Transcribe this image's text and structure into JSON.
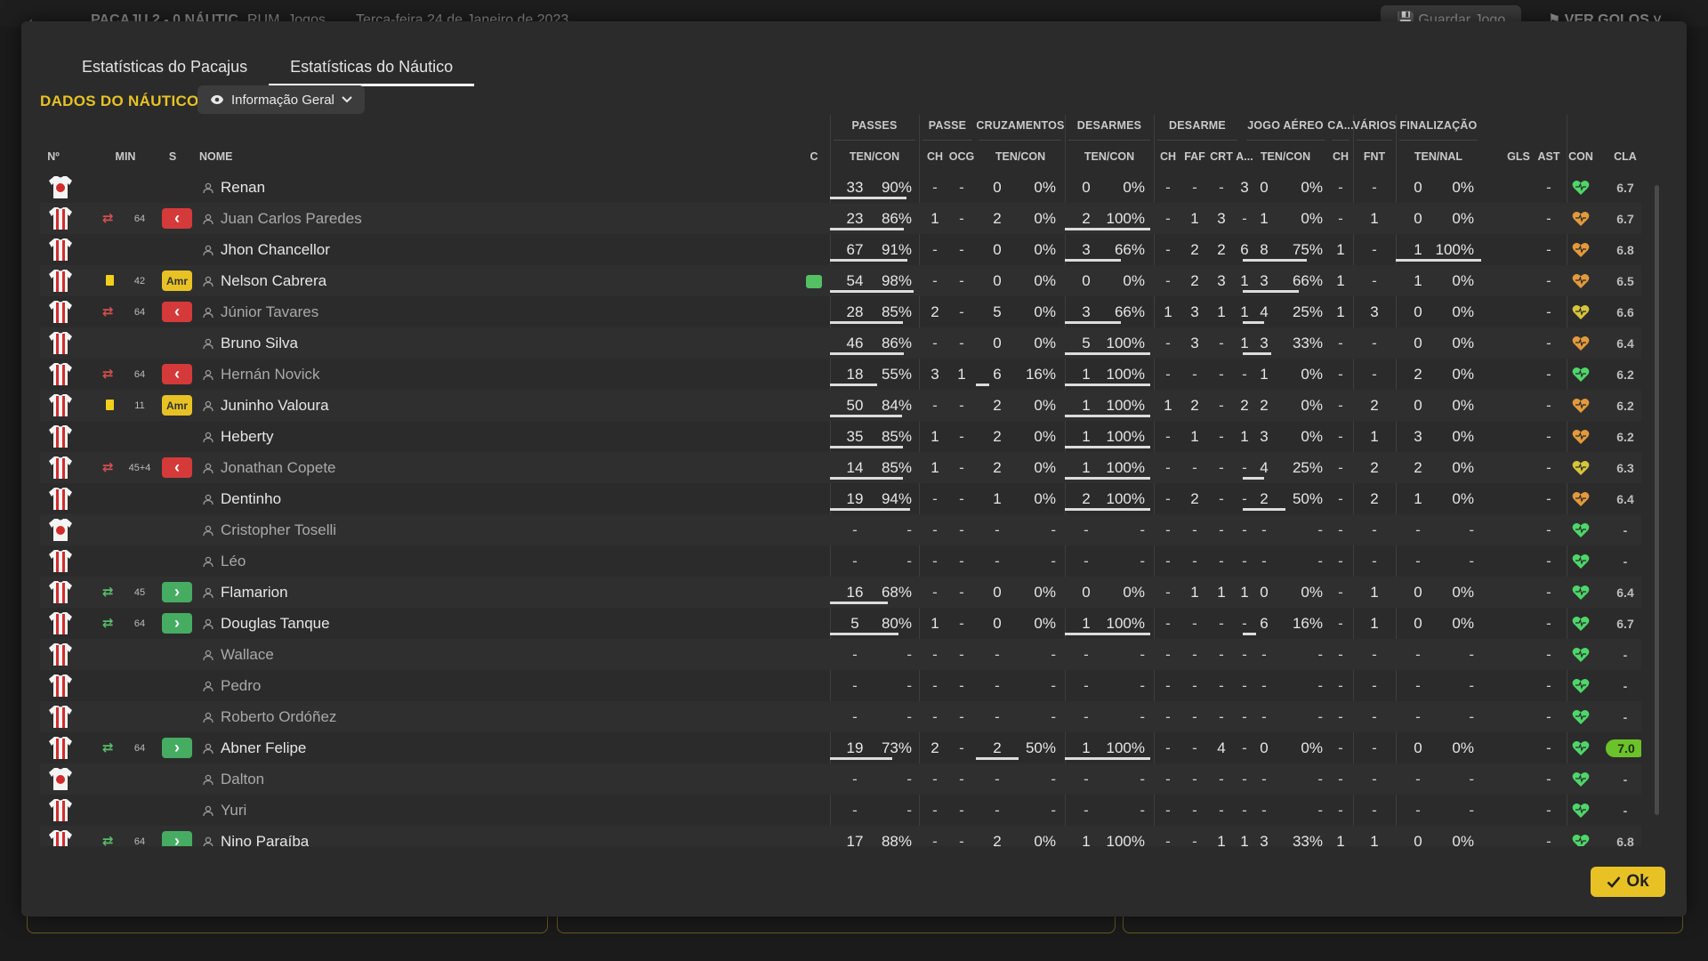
{
  "header": {
    "back_icon": "arrow-left-icon",
    "match": "PACAJU 2 - 0 NÁUTIC",
    "subtitle": "RUM, Jogos",
    "date": "Terça-feira 24 de Janeiro de 2023",
    "save_label": "Guardar Jogo",
    "goals_label": "VER GOLOS"
  },
  "tabs": [
    {
      "label": "Estatísticas do Pacajus",
      "active": false
    },
    {
      "label": "Estatísticas do Náutico",
      "active": true
    }
  ],
  "section_title": "DADOS DO NÁUTICO",
  "view_dropdown": {
    "label": "Informação Geral",
    "icon": "eye-icon"
  },
  "ok_label": "Ok",
  "group_headers": {
    "passes": "PASSES",
    "passe": "PASSE",
    "cruz": "CRUZAMENTOS",
    "desarmes": "DESARMES",
    "desarme": "DESARME",
    "jogo_aereo": "JOGO AÉREO",
    "ca": "CA...",
    "varios": "VÁRIOS",
    "finalizacao": "FINALIZAÇÃO"
  },
  "columns": {
    "num": "Nº",
    "min": "MIN",
    "s": "S",
    "nome": "NOME",
    "c": "C",
    "passes": "TEN/CON",
    "passe_ch": "CH",
    "passe_ocg": "OCG",
    "cruz": "TEN/CON",
    "desarmes": "TEN/CON",
    "desarme_ch": "CH",
    "desarme_faf": "FAF",
    "desarme_crt": "CRT",
    "desarme_a": "A...",
    "aereo": "TEN/CON",
    "ca_ch": "CH",
    "varios_fnt": "FNT",
    "final": "TEN/NAL",
    "gls": "GLS",
    "ast": "AST",
    "con": "CON",
    "cla": "CLA"
  },
  "colors": {
    "accent": "#e8c224",
    "sub_out": "#d53a3a",
    "sub_in": "#46ac62",
    "heart_green": "#4ed66a",
    "heart_orange": "#e39a3c",
    "heart_yellow": "#d6c53a"
  },
  "players": [
    {
      "kit": "white",
      "name": "Renan",
      "active": true,
      "min": "",
      "sub": "",
      "card": "",
      "pt": "33",
      "pc": "90%",
      "pp": 0.9,
      "pch": "-",
      "ocg": "-",
      "ct": "0",
      "cc": "0%",
      "cp": 0,
      "dt": "0",
      "dc": "0%",
      "dp": 0,
      "d_ch": "-",
      "faf": "-",
      "crt": "-",
      "da": "3",
      "at": "0",
      "ac": "0%",
      "ap": 0,
      "ca": "-",
      "fnt": "-",
      "ft": "0",
      "fc": "0%",
      "fp": 0,
      "gls": "",
      "ast": "-",
      "con": "green",
      "cla": "6.7",
      "best": false,
      "kitmark": false
    },
    {
      "kit": "striped",
      "name": "Juan Carlos Paredes",
      "active": false,
      "min": "64",
      "sub": "out",
      "card": "",
      "pt": "23",
      "pc": "86%",
      "pp": 0.86,
      "pch": "1",
      "ocg": "-",
      "ct": "2",
      "cc": "0%",
      "cp": 0,
      "dt": "2",
      "dc": "100%",
      "dp": 1,
      "d_ch": "-",
      "faf": "1",
      "crt": "3",
      "da": "-",
      "at": "1",
      "ac": "0%",
      "ap": 0,
      "ca": "-",
      "fnt": "1",
      "ft": "0",
      "fc": "0%",
      "fp": 0,
      "gls": "",
      "ast": "-",
      "con": "orange",
      "cla": "6.7",
      "best": false,
      "kitmark": false
    },
    {
      "kit": "striped",
      "name": "Jhon Chancellor",
      "active": true,
      "min": "",
      "sub": "",
      "card": "",
      "pt": "67",
      "pc": "91%",
      "pp": 0.91,
      "pch": "-",
      "ocg": "-",
      "ct": "0",
      "cc": "0%",
      "cp": 0,
      "dt": "3",
      "dc": "66%",
      "dp": 0.66,
      "d_ch": "-",
      "faf": "2",
      "crt": "2",
      "da": "6",
      "at": "8",
      "ac": "75%",
      "ap": 0.75,
      "ca": "1",
      "fnt": "-",
      "ft": "1",
      "fc": "100%",
      "fp": 1,
      "gls": "",
      "ast": "-",
      "con": "orange",
      "cla": "6.8",
      "best": false,
      "kitmark": false
    },
    {
      "kit": "striped",
      "name": "Nelson Cabrera",
      "active": true,
      "min": "42",
      "sub": "",
      "card": "yellow",
      "pt": "54",
      "pc": "98%",
      "pp": 0.98,
      "pch": "-",
      "ocg": "-",
      "ct": "0",
      "cc": "0%",
      "cp": 0,
      "dt": "0",
      "dc": "0%",
      "dp": 0,
      "d_ch": "-",
      "faf": "2",
      "crt": "3",
      "da": "1",
      "at": "3",
      "ac": "66%",
      "ap": 0.66,
      "ca": "1",
      "fnt": "-",
      "ft": "1",
      "fc": "0%",
      "fp": 0,
      "gls": "",
      "ast": "-",
      "con": "orange",
      "cla": "6.5",
      "best": false,
      "kitmark": true
    },
    {
      "kit": "striped",
      "name": "Júnior Tavares",
      "active": false,
      "min": "64",
      "sub": "out",
      "card": "",
      "pt": "28",
      "pc": "85%",
      "pp": 0.85,
      "pch": "2",
      "ocg": "-",
      "ct": "5",
      "cc": "0%",
      "cp": 0,
      "dt": "3",
      "dc": "66%",
      "dp": 0.66,
      "d_ch": "1",
      "faf": "3",
      "crt": "1",
      "da": "1",
      "at": "4",
      "ac": "25%",
      "ap": 0.25,
      "ca": "1",
      "fnt": "3",
      "ft": "0",
      "fc": "0%",
      "fp": 0,
      "gls": "",
      "ast": "-",
      "con": "yellow",
      "cla": "6.6",
      "best": false,
      "kitmark": false
    },
    {
      "kit": "striped",
      "name": "Bruno Silva",
      "active": true,
      "min": "",
      "sub": "",
      "card": "",
      "pt": "46",
      "pc": "86%",
      "pp": 0.86,
      "pch": "-",
      "ocg": "-",
      "ct": "0",
      "cc": "0%",
      "cp": 0,
      "dt": "5",
      "dc": "100%",
      "dp": 1,
      "d_ch": "-",
      "faf": "3",
      "crt": "-",
      "da": "1",
      "at": "3",
      "ac": "33%",
      "ap": 0.33,
      "ca": "-",
      "fnt": "-",
      "ft": "0",
      "fc": "0%",
      "fp": 0,
      "gls": "",
      "ast": "-",
      "con": "orange",
      "cla": "6.4",
      "best": false,
      "kitmark": false
    },
    {
      "kit": "striped",
      "name": "Hernán Novick",
      "active": false,
      "min": "64",
      "sub": "out",
      "card": "",
      "pt": "18",
      "pc": "55%",
      "pp": 0.55,
      "pch": "3",
      "ocg": "1",
      "ct": "6",
      "cc": "16%",
      "cp": 0.16,
      "dt": "1",
      "dc": "100%",
      "dp": 1,
      "d_ch": "-",
      "faf": "-",
      "crt": "-",
      "da": "-",
      "at": "1",
      "ac": "0%",
      "ap": 0,
      "ca": "-",
      "fnt": "-",
      "ft": "2",
      "fc": "0%",
      "fp": 0,
      "gls": "",
      "ast": "-",
      "con": "green",
      "cla": "6.2",
      "best": false,
      "kitmark": false
    },
    {
      "kit": "striped",
      "name": "Juninho Valoura",
      "active": true,
      "min": "11",
      "sub": "",
      "card": "yellow",
      "pt": "50",
      "pc": "84%",
      "pp": 0.84,
      "pch": "-",
      "ocg": "-",
      "ct": "2",
      "cc": "0%",
      "cp": 0,
      "dt": "1",
      "dc": "100%",
      "dp": 1,
      "d_ch": "1",
      "faf": "2",
      "crt": "-",
      "da": "2",
      "at": "2",
      "ac": "0%",
      "ap": 0,
      "ca": "-",
      "fnt": "2",
      "ft": "0",
      "fc": "0%",
      "fp": 0,
      "gls": "",
      "ast": "-",
      "con": "orange",
      "cla": "6.2",
      "best": false,
      "kitmark": false
    },
    {
      "kit": "striped",
      "name": "Heberty",
      "active": true,
      "min": "",
      "sub": "",
      "card": "",
      "pt": "35",
      "pc": "85%",
      "pp": 0.85,
      "pch": "1",
      "ocg": "-",
      "ct": "2",
      "cc": "0%",
      "cp": 0,
      "dt": "1",
      "dc": "100%",
      "dp": 1,
      "d_ch": "-",
      "faf": "1",
      "crt": "-",
      "da": "1",
      "at": "3",
      "ac": "0%",
      "ap": 0,
      "ca": "-",
      "fnt": "1",
      "ft": "3",
      "fc": "0%",
      "fp": 0,
      "gls": "",
      "ast": "-",
      "con": "orange",
      "cla": "6.2",
      "best": false,
      "kitmark": false
    },
    {
      "kit": "striped",
      "name": "Jonathan Copete",
      "active": false,
      "min": "45+4",
      "sub": "out",
      "card": "",
      "pt": "14",
      "pc": "85%",
      "pp": 0.85,
      "pch": "1",
      "ocg": "-",
      "ct": "2",
      "cc": "0%",
      "cp": 0,
      "dt": "1",
      "dc": "100%",
      "dp": 1,
      "d_ch": "-",
      "faf": "-",
      "crt": "-",
      "da": "-",
      "at": "4",
      "ac": "25%",
      "ap": 0.25,
      "ca": "-",
      "fnt": "2",
      "ft": "2",
      "fc": "0%",
      "fp": 0,
      "gls": "",
      "ast": "-",
      "con": "yellow",
      "cla": "6.3",
      "best": false,
      "kitmark": false
    },
    {
      "kit": "striped",
      "name": "Dentinho",
      "active": true,
      "min": "",
      "sub": "",
      "card": "",
      "pt": "19",
      "pc": "94%",
      "pp": 0.94,
      "pch": "-",
      "ocg": "-",
      "ct": "1",
      "cc": "0%",
      "cp": 0,
      "dt": "2",
      "dc": "100%",
      "dp": 1,
      "d_ch": "-",
      "faf": "2",
      "crt": "-",
      "da": "-",
      "at": "2",
      "ac": "50%",
      "ap": 0.5,
      "ca": "-",
      "fnt": "2",
      "ft": "1",
      "fc": "0%",
      "fp": 0,
      "gls": "",
      "ast": "-",
      "con": "orange",
      "cla": "6.4",
      "best": false,
      "kitmark": false
    },
    {
      "kit": "white",
      "name": "Cristopher Toselli",
      "active": false,
      "min": "",
      "sub": "",
      "card": "",
      "pt": "-",
      "pc": "-",
      "pp": 0,
      "pch": "-",
      "ocg": "-",
      "ct": "-",
      "cc": "-",
      "cp": 0,
      "dt": "-",
      "dc": "-",
      "dp": 0,
      "d_ch": "-",
      "faf": "-",
      "crt": "-",
      "da": "-",
      "at": "-",
      "ac": "-",
      "ap": 0,
      "ca": "-",
      "fnt": "-",
      "ft": "-",
      "fc": "-",
      "fp": 0,
      "gls": "",
      "ast": "-",
      "con": "green",
      "cla": "-",
      "best": false,
      "kitmark": false
    },
    {
      "kit": "striped",
      "name": "Léo",
      "active": false,
      "min": "",
      "sub": "",
      "card": "",
      "pt": "-",
      "pc": "-",
      "pp": 0,
      "pch": "-",
      "ocg": "-",
      "ct": "-",
      "cc": "-",
      "cp": 0,
      "dt": "-",
      "dc": "-",
      "dp": 0,
      "d_ch": "-",
      "faf": "-",
      "crt": "-",
      "da": "-",
      "at": "-",
      "ac": "-",
      "ap": 0,
      "ca": "-",
      "fnt": "-",
      "ft": "-",
      "fc": "-",
      "fp": 0,
      "gls": "",
      "ast": "-",
      "con": "green",
      "cla": "-",
      "best": false,
      "kitmark": false
    },
    {
      "kit": "striped",
      "name": "Flamarion",
      "active": true,
      "min": "45",
      "sub": "in",
      "card": "",
      "pt": "16",
      "pc": "68%",
      "pp": 0.68,
      "pch": "-",
      "ocg": "-",
      "ct": "0",
      "cc": "0%",
      "cp": 0,
      "dt": "0",
      "dc": "0%",
      "dp": 0,
      "d_ch": "-",
      "faf": "1",
      "crt": "1",
      "da": "1",
      "at": "0",
      "ac": "0%",
      "ap": 0,
      "ca": "-",
      "fnt": "1",
      "ft": "0",
      "fc": "0%",
      "fp": 0,
      "gls": "",
      "ast": "-",
      "con": "green",
      "cla": "6.4",
      "best": false,
      "kitmark": false
    },
    {
      "kit": "striped",
      "name": "Douglas Tanque",
      "active": true,
      "min": "64",
      "sub": "in",
      "card": "",
      "pt": "5",
      "pc": "80%",
      "pp": 0.8,
      "pch": "1",
      "ocg": "-",
      "ct": "0",
      "cc": "0%",
      "cp": 0,
      "dt": "1",
      "dc": "100%",
      "dp": 1,
      "d_ch": "-",
      "faf": "-",
      "crt": "-",
      "da": "-",
      "at": "6",
      "ac": "16%",
      "ap": 0.16,
      "ca": "-",
      "fnt": "1",
      "ft": "0",
      "fc": "0%",
      "fp": 0,
      "gls": "",
      "ast": "-",
      "con": "green",
      "cla": "6.7",
      "best": false,
      "kitmark": false
    },
    {
      "kit": "striped",
      "name": "Wallace",
      "active": false,
      "min": "",
      "sub": "",
      "card": "",
      "pt": "-",
      "pc": "-",
      "pp": 0,
      "pch": "-",
      "ocg": "-",
      "ct": "-",
      "cc": "-",
      "cp": 0,
      "dt": "-",
      "dc": "-",
      "dp": 0,
      "d_ch": "-",
      "faf": "-",
      "crt": "-",
      "da": "-",
      "at": "-",
      "ac": "-",
      "ap": 0,
      "ca": "-",
      "fnt": "-",
      "ft": "-",
      "fc": "-",
      "fp": 0,
      "gls": "",
      "ast": "-",
      "con": "green",
      "cla": "-",
      "best": false,
      "kitmark": false
    },
    {
      "kit": "striped",
      "name": "Pedro",
      "active": false,
      "min": "",
      "sub": "",
      "card": "",
      "pt": "-",
      "pc": "-",
      "pp": 0,
      "pch": "-",
      "ocg": "-",
      "ct": "-",
      "cc": "-",
      "cp": 0,
      "dt": "-",
      "dc": "-",
      "dp": 0,
      "d_ch": "-",
      "faf": "-",
      "crt": "-",
      "da": "-",
      "at": "-",
      "ac": "-",
      "ap": 0,
      "ca": "-",
      "fnt": "-",
      "ft": "-",
      "fc": "-",
      "fp": 0,
      "gls": "",
      "ast": "-",
      "con": "green",
      "cla": "-",
      "best": false,
      "kitmark": false
    },
    {
      "kit": "striped",
      "name": "Roberto Ordóñez",
      "active": false,
      "min": "",
      "sub": "",
      "card": "",
      "pt": "-",
      "pc": "-",
      "pp": 0,
      "pch": "-",
      "ocg": "-",
      "ct": "-",
      "cc": "-",
      "cp": 0,
      "dt": "-",
      "dc": "-",
      "dp": 0,
      "d_ch": "-",
      "faf": "-",
      "crt": "-",
      "da": "-",
      "at": "-",
      "ac": "-",
      "ap": 0,
      "ca": "-",
      "fnt": "-",
      "ft": "-",
      "fc": "-",
      "fp": 0,
      "gls": "",
      "ast": "-",
      "con": "green",
      "cla": "-",
      "best": false,
      "kitmark": false
    },
    {
      "kit": "striped",
      "name": "Abner Felipe",
      "active": true,
      "min": "64",
      "sub": "in",
      "card": "",
      "pt": "19",
      "pc": "73%",
      "pp": 0.73,
      "pch": "2",
      "ocg": "-",
      "ct": "2",
      "cc": "50%",
      "cp": 0.5,
      "dt": "1",
      "dc": "100%",
      "dp": 1,
      "d_ch": "-",
      "faf": "-",
      "crt": "4",
      "da": "-",
      "at": "0",
      "ac": "0%",
      "ap": 0,
      "ca": "-",
      "fnt": "-",
      "ft": "0",
      "fc": "0%",
      "fp": 0,
      "gls": "",
      "ast": "-",
      "con": "green",
      "cla": "7.0",
      "best": true,
      "kitmark": false
    },
    {
      "kit": "white",
      "name": "Dalton",
      "active": false,
      "min": "",
      "sub": "",
      "card": "",
      "pt": "-",
      "pc": "-",
      "pp": 0,
      "pch": "-",
      "ocg": "-",
      "ct": "-",
      "cc": "-",
      "cp": 0,
      "dt": "-",
      "dc": "-",
      "dp": 0,
      "d_ch": "-",
      "faf": "-",
      "crt": "-",
      "da": "-",
      "at": "-",
      "ac": "-",
      "ap": 0,
      "ca": "-",
      "fnt": "-",
      "ft": "-",
      "fc": "-",
      "fp": 0,
      "gls": "",
      "ast": "-",
      "con": "green",
      "cla": "-",
      "best": false,
      "kitmark": false
    },
    {
      "kit": "striped",
      "name": "Yuri",
      "active": false,
      "min": "",
      "sub": "",
      "card": "",
      "pt": "-",
      "pc": "-",
      "pp": 0,
      "pch": "-",
      "ocg": "-",
      "ct": "-",
      "cc": "-",
      "cp": 0,
      "dt": "-",
      "dc": "-",
      "dp": 0,
      "d_ch": "-",
      "faf": "-",
      "crt": "-",
      "da": "-",
      "at": "-",
      "ac": "-",
      "ap": 0,
      "ca": "-",
      "fnt": "-",
      "ft": "-",
      "fc": "-",
      "fp": 0,
      "gls": "",
      "ast": "-",
      "con": "green",
      "cla": "-",
      "best": false,
      "kitmark": false
    },
    {
      "kit": "striped",
      "name": "Nino Paraíba",
      "active": true,
      "min": "64",
      "sub": "in",
      "card": "",
      "pt": "17",
      "pc": "88%",
      "pp": 0.88,
      "pch": "-",
      "ocg": "-",
      "ct": "2",
      "cc": "0%",
      "cp": 0,
      "dt": "1",
      "dc": "100%",
      "dp": 1,
      "d_ch": "-",
      "faf": "-",
      "crt": "1",
      "da": "1",
      "at": "3",
      "ac": "33%",
      "ap": 0.33,
      "ca": "1",
      "fnt": "1",
      "ft": "0",
      "fc": "0%",
      "fp": 0,
      "gls": "",
      "ast": "-",
      "con": "green",
      "cla": "6.8",
      "best": false,
      "kitmark": false
    }
  ]
}
